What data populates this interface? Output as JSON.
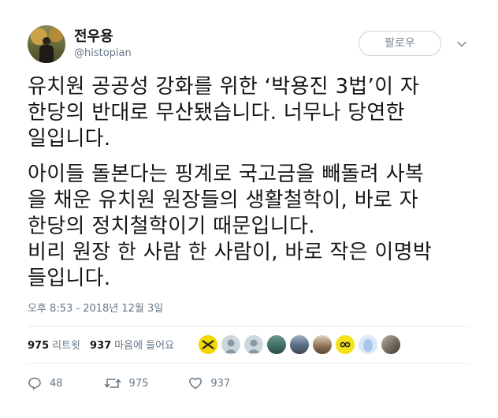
{
  "author": {
    "name": "전우용",
    "handle": "@histopian"
  },
  "follow_button": {
    "label": "팔로우"
  },
  "tweet": {
    "paragraphs": [
      "유치원 공공성 강화를 위한 ‘박용진 3법’이 자\n한당의 반대로 무산됐습니다. 너무나 당연한\n일입니다.",
      "아이들 돌본다는 핑계로 국고금을 빼돌려 사복\n을 채운 유치원 원장들의 생활철학이, 바로 자\n한당의 정치철학이기 때문입니다.\n비리 원장 한 사람 한 사람이, 바로 작은 이명박\n들입니다."
    ],
    "timestamp": "오후 8:53 - 2018년 12월 3일"
  },
  "stats": {
    "retweets": {
      "count": "975",
      "label": "리트윗"
    },
    "likes": {
      "count": "937",
      "label": "마음에 들어요"
    }
  },
  "likers": [
    {
      "icon": "yellow-ribbon-avatar"
    },
    {
      "icon": "default-avatar"
    },
    {
      "icon": "default-avatar"
    },
    {
      "icon": "landscape-avatar"
    },
    {
      "icon": "landscape-avatar"
    },
    {
      "icon": "figure-avatar"
    },
    {
      "icon": "yellow-logo-avatar"
    },
    {
      "icon": "egg-avatar"
    },
    {
      "icon": "photo-avatar"
    }
  ],
  "actions": {
    "reply_count": "48",
    "retweet_count": "975",
    "like_count": "937"
  },
  "colors": {
    "text": "#14171a",
    "muted": "#657786",
    "divider": "#e6ecf0",
    "ribbon": "#f2d600"
  }
}
